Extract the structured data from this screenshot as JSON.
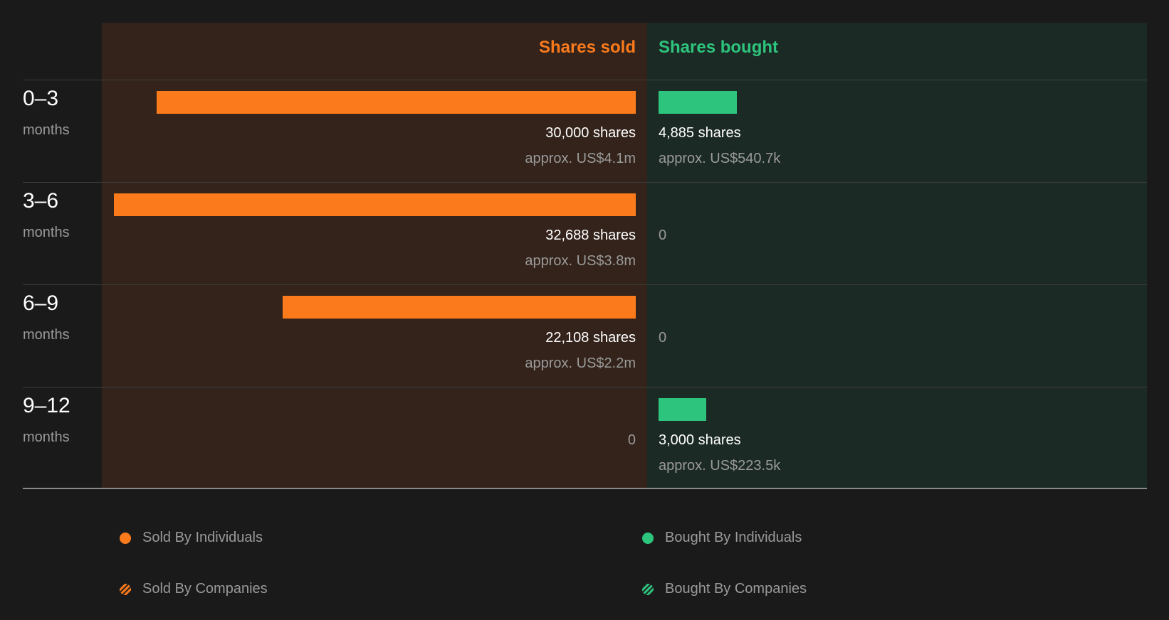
{
  "chart_data": {
    "type": "bar",
    "categories": [
      "0-3",
      "3-6",
      "6-9",
      "9-12"
    ],
    "category_unit": "months",
    "headers": {
      "sold": "Shares sold",
      "bought": "Shares bought"
    },
    "series": [
      {
        "name": "Shares sold",
        "values": [
          30000,
          32688,
          22108,
          0
        ],
        "shares_labels": [
          "30,000 shares",
          "32,688 shares",
          "22,108 shares",
          "0"
        ],
        "value_labels": [
          "approx. US$4.1m",
          "approx. US$3.8m",
          "approx. US$2.2m",
          ""
        ]
      },
      {
        "name": "Shares bought",
        "values": [
          4885,
          0,
          0,
          3000
        ],
        "shares_labels": [
          "4,885 shares",
          "0",
          "0",
          "3,000 shares"
        ],
        "value_labels": [
          "approx. US$540.7k",
          "",
          "",
          "approx. US$223.5k"
        ]
      }
    ],
    "max_value": 32688,
    "legend": [
      "Sold By Individuals",
      "Bought By Individuals",
      "Sold By Companies",
      "Bought By Companies"
    ],
    "colors": {
      "sold": "#fb7b1c",
      "bought": "#2dc57d"
    }
  },
  "rows": [
    {
      "period": "0–3",
      "unit": "months"
    },
    {
      "period": "3–6",
      "unit": "months"
    },
    {
      "period": "6–9",
      "unit": "months"
    },
    {
      "period": "9–12",
      "unit": "months"
    }
  ]
}
